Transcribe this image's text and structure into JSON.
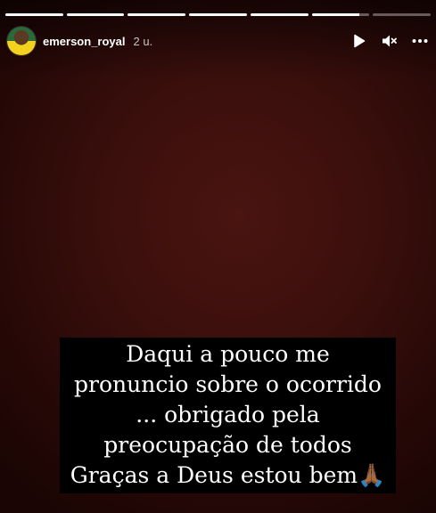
{
  "story": {
    "username": "emerson_royal",
    "time": "2 u.",
    "progress": [
      1,
      1,
      1,
      1,
      1,
      0.82,
      0
    ]
  },
  "icons": {
    "play": "play-icon",
    "mute": "muted-speaker-icon",
    "more": "more-options-icon"
  },
  "caption": {
    "lines": [
      "Daqui a pouco me",
      "pronuncio sobre o ocorrido",
      "... obrigado pela",
      "preocupação de todos",
      "Graças a Deus estou bem🙏🏾"
    ]
  }
}
